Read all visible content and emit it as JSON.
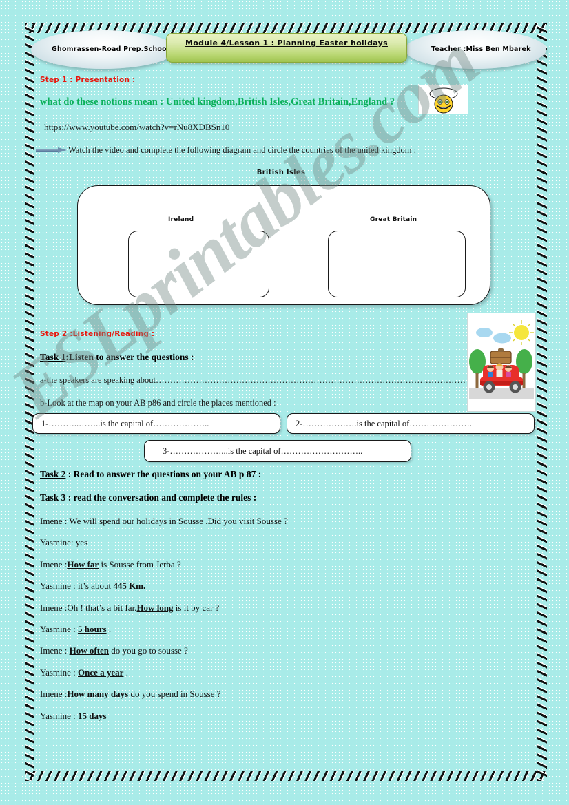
{
  "header": {
    "school": "Ghomrassen-Road Prep.School",
    "title": "Module 4/Lesson 1 : Planning Easter holidays",
    "teacher": "Teacher :Miss Ben Mbarek"
  },
  "step1": {
    "heading": "Step 1 : Presentation :",
    "question": "what do these notions mean : United kingdom,British Isles,Great Britain,England ?",
    "video_url": "https://www.youtube.com/watch?v=rNu8XDBSn10",
    "instruction": "Watch the video and complete the following diagram and circle the countries of the united kingdom :",
    "smiley_icon": "thinking-smiley-icon"
  },
  "diagram": {
    "outer_label": "British Isles",
    "left_label": "Ireland",
    "right_label": "Great Britain"
  },
  "step2": {
    "heading": "Step 2  :Listening/Reading :",
    "task1_label": "Task 1",
    "task1_text": ":Listen to answer the questions :",
    "item_a": "a-the speakers are speaking about………………………………………………………………………………………………",
    "item_b": "b-Look at the map on your AB p86 and circle the places mentioned :",
    "capital_boxes": [
      "1-………..……..is the capital of………………..",
      "2-……………….is the capital of………………….",
      "3-………………...is the capital of……………………….."
    ],
    "car_image": "family-car-holiday-image"
  },
  "task2": {
    "label": "Task 2",
    "text": " : Read to answer the questions on your AB p 87 :"
  },
  "task3": {
    "heading": "Task 3 : read the conversation and complete the rules :"
  },
  "conversation": [
    {
      "speaker": "Imene : ",
      "pre": "We will spend our holidays in Sousse .Did you visit Sousse  ?",
      "key": "",
      "post": ""
    },
    {
      "speaker": "Yasmine: ",
      "pre": "yes",
      "key": "",
      "post": ""
    },
    {
      "speaker": "Imene :",
      "pre": "",
      "key": "How far",
      "post": " is Sousse from Jerba ?"
    },
    {
      "speaker": "Yasmine : ",
      "pre": "it’s about ",
      "key": "",
      "post": "445 Km.",
      "bold_post": true
    },
    {
      "speaker": "Imene :",
      "pre": "Oh ! that’s a bit far.",
      "key": "How long",
      "post": " is it by car ?"
    },
    {
      "speaker": "Yasmine : ",
      "pre": "",
      "key": "5 hours",
      "post": " ."
    },
    {
      "speaker": "Imene : ",
      "pre": "",
      "key": "How often",
      "post": " do you go to sousse ?"
    },
    {
      "speaker": "Yasmine : ",
      "pre": "",
      "key": "Once a year",
      "post": " ."
    },
    {
      "speaker": "Imene :",
      "pre": "",
      "key": "How many days",
      "post": " do you spend in Sousse ?"
    },
    {
      "speaker": "Yasmine : ",
      "pre": "",
      "key": "15 days",
      "post": ""
    }
  ],
  "watermark": {
    "text": "ESLprintables.com"
  },
  "colors": {
    "page_background": "#a8ebe8",
    "step_heading_red": "#e8160c",
    "question_green": "#0bb05a",
    "title_banner_green": "#bcd977"
  }
}
